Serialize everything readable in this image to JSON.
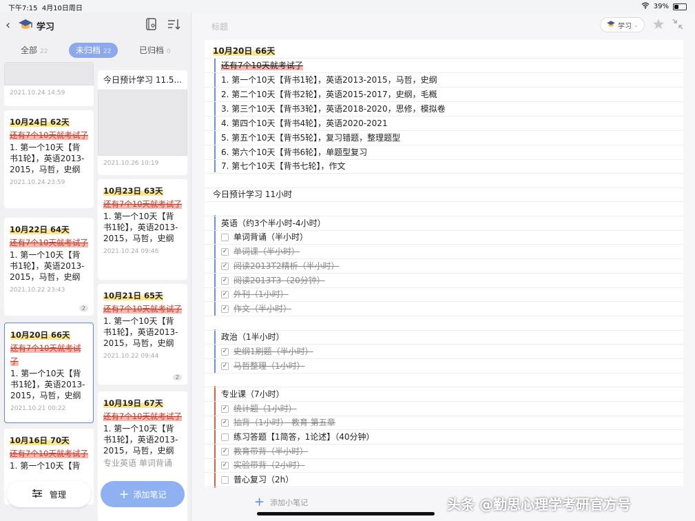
{
  "status": {
    "time": "下午7:15",
    "date": "4月10日周日",
    "battery": "39%",
    "battery_level": 0.39
  },
  "left": {
    "folder_title": "学习",
    "tabs": [
      {
        "label": "全部",
        "count": "22"
      },
      {
        "label": "未归档",
        "count": "22"
      },
      {
        "label": "已归档",
        "count": "0"
      }
    ],
    "col1": [
      {
        "date": "2021.10.24 14:59"
      },
      {
        "title": "10月24日 62天",
        "strike": "还有7个10天就考试了",
        "body": "1. 第一个10天【背书1轮】，英语2013-2015，马哲，史纲",
        "date": "2021.10.24 23:59"
      },
      {
        "title": "10月22日 64天",
        "strike": "还有7个10天就考试了",
        "body": "1. 第一个10天【背书1轮】，英语2013-2015，马哲，史纲",
        "date": "2021.10.22 23:43",
        "badge": "2"
      },
      {
        "title": "10月20日 66天",
        "strike": "还有7个10天就考试了",
        "body": "1. 第一个10天【背书1轮】，英语2013-2015，马哲，史纲",
        "date": "2021.10.21 00:22"
      },
      {
        "title": "10月16日 70天",
        "strike": "还有7个10天就考试了",
        "body": "1. 第一个10天【背"
      }
    ],
    "col2": [
      {
        "plain": "今日预计学习 11.5...",
        "date": "2021.10.26 10:19"
      },
      {
        "title": "10月23日 63天",
        "strike": "还有7个10天就考试了",
        "body": "1. 第一个10天【背书1轮】，英语2013-2015，马哲，史纲",
        "date": "2021.10.24 09:46"
      },
      {
        "title": "10月21日 65天",
        "strike": "还有7个10天就考试了",
        "body": "1. 第一个10天【背书1轮】，英语2013-2015，马哲，史纲",
        "date": "2021.10.22 09:44",
        "badge": "2"
      },
      {
        "title": "10月19日 67天",
        "strike": "还有7个10天就考试了",
        "body": "1. 第一个10天【背书1轮】，英语2013-2015，马哲，史纲",
        "extra": "专业英语  单词背诵"
      }
    ],
    "manage_label": "管理",
    "add_note_label": "添加笔记"
  },
  "right": {
    "title_placeholder": "标题",
    "tag": "学习",
    "add_small_note": "添加小笔记",
    "heading": "10月20日 66天",
    "plan_strike": "还有7个10天就考试了",
    "plan": [
      "1. 第一个10天【背书1轮】，英语2013-2015，马哲，史纲",
      "2. 第二个10天【背书2轮】，英语2015-2017，史纲，毛概",
      "3. 第三个10天【背书3轮】，英语2018-2020，思修，模拟卷",
      "4. 第四个10天【背书4轮】，英语2020-2021",
      "5. 第五个10天【背书5轮】，复习错题，整理题型",
      "6. 第六个10天【背书6轮】，单题型复习",
      "7. 第七个10天【背书七轮】，作文"
    ],
    "today": "今日预计学习 11小时",
    "english": {
      "title": "英语（约3个半小时-4小时）",
      "items": [
        {
          "text": "单词背诵（半小时）",
          "done": false
        },
        {
          "text": "单词课（半小时）",
          "done": true
        },
        {
          "text": "阅读2013T2精析（半小时）",
          "done": true
        },
        {
          "text": "阅读2013T3（20分钟）",
          "done": true
        },
        {
          "text": "外刊（1小时）",
          "done": true
        },
        {
          "text": "作文（半小时）",
          "done": true
        }
      ]
    },
    "politics": {
      "title": "政治（1半小时）",
      "items": [
        {
          "text": "史纲1刷题（半小时）",
          "done": true
        },
        {
          "text": "马哲整理（1小时）",
          "done": true
        }
      ]
    },
    "major": {
      "title": "专业课（7小时）",
      "items": [
        {
          "text": "统计题（1小时）",
          "done": true
        },
        {
          "text": "抽背（1小时）-教育 第五章",
          "done": true
        },
        {
          "text": "练习答题【1简答，1论述】（40分钟）",
          "done": false
        },
        {
          "text": "教育带背（半小时）",
          "done": true
        },
        {
          "text": "实验带背（2小时）",
          "done": true
        },
        {
          "text": "普心复习（2h）",
          "done": false
        }
      ]
    },
    "watermark": "头条 @勤思心理学考研官方号"
  },
  "colors": {
    "accent": "#8da9ec",
    "highlight": "#fde68a",
    "strike_red": "#f6b8ae",
    "blue_bar": "#6a8fe6",
    "red_bar": "#e05a4a"
  }
}
